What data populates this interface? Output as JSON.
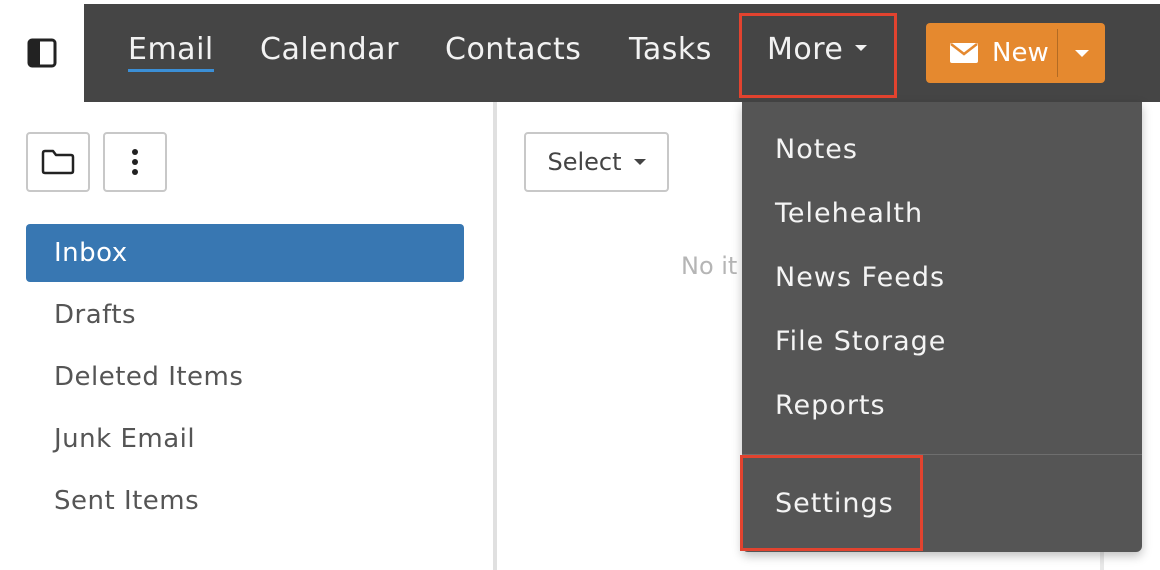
{
  "topbar": {
    "tabs": [
      {
        "label": "Email"
      },
      {
        "label": "Calendar"
      },
      {
        "label": "Contacts"
      },
      {
        "label": "Tasks"
      }
    ],
    "more_label": "More",
    "new_label": "New"
  },
  "more_menu": {
    "items": [
      {
        "label": "Notes"
      },
      {
        "label": "Telehealth"
      },
      {
        "label": "News Feeds"
      },
      {
        "label": "File Storage"
      },
      {
        "label": "Reports"
      }
    ],
    "settings_label": "Settings"
  },
  "folders": {
    "items": [
      {
        "label": "Inbox"
      },
      {
        "label": "Drafts"
      },
      {
        "label": "Deleted Items"
      },
      {
        "label": "Junk Email"
      },
      {
        "label": "Sent Items"
      }
    ]
  },
  "message_list": {
    "select_label": "Select",
    "empty_text": "No it"
  },
  "colors": {
    "topbar_bg": "#454545",
    "active_folder": "#3877b2",
    "new_button": "#e5892f",
    "highlight": "#e2432f",
    "menu_bg": "#555555"
  }
}
